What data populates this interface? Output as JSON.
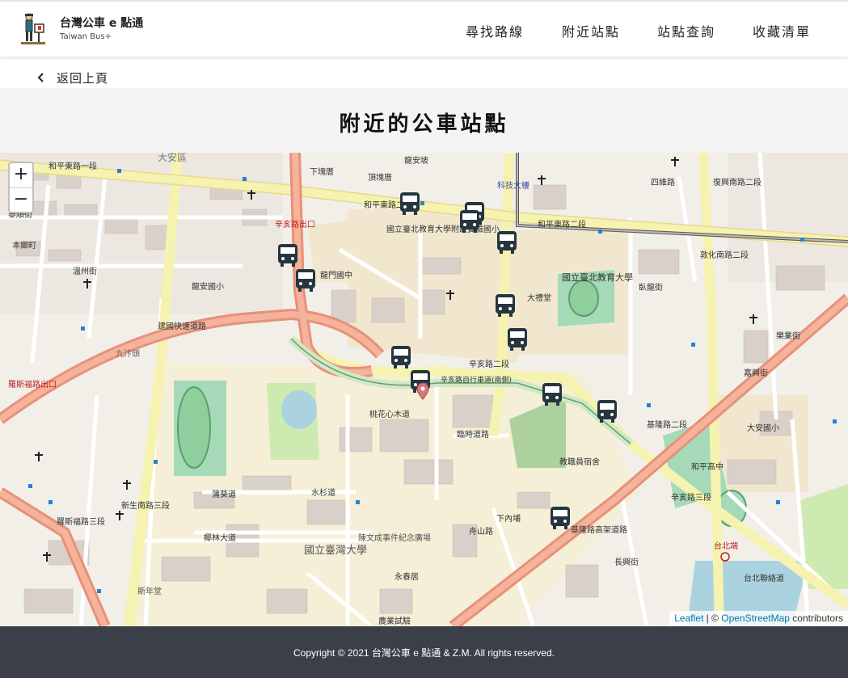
{
  "header": {
    "brand_title": "台灣公車 e 點通",
    "brand_subtitle": "Taiwan Bus+",
    "nav": [
      "尋找路線",
      "附近站點",
      "站點查詢",
      "收藏清單"
    ]
  },
  "back_label": "返回上頁",
  "page_title": "附近的公車站點",
  "map": {
    "zoom_in": "+",
    "zoom_out": "−",
    "attribution": {
      "leaflet": "Leaflet",
      "separator": " | © ",
      "osm": "OpenStreetMap",
      "contributors": " contributors"
    },
    "labels": {
      "l1": "大安區",
      "l2": "和平東路一段",
      "l3": "和平東路二段",
      "l4": "和平東路二段",
      "l5": "辛亥路出口",
      "l6": "龍門國中",
      "l7": "國立臺北教育大學附設實驗國小",
      "l8": "國立臺北教育大學",
      "l9": "大禮堂",
      "l10": "科技大樓",
      "l11": "辛亥路二段",
      "l12": "建國快速道路",
      "l13": "九汴頭",
      "l14": "羅斯福路出口",
      "l15": "辛亥路自行車道(南側)",
      "l16": "桃花心木道",
      "l17": "臨時道路",
      "l18": "教職員宿舍",
      "l19": "蒲葵道",
      "l20": "水杉道",
      "l21": "椰林大道",
      "l22": "國立臺灣大學",
      "l23": "陳文成事件紀念廣場",
      "l24": "舟山路",
      "l25": "永春居",
      "l26": "基隆路高架道路",
      "l27": "基隆路二段",
      "l28": "和平高中",
      "l29": "大安國小",
      "l30": "台北端",
      "l31": "台北聯絡道",
      "l32": "下內埔",
      "l33": "農業試驗",
      "l34": "斯年堂",
      "l35": "龍安國小",
      "l36": "新生南路三段",
      "l37": "羅斯福路三段",
      "l38": "復興南路二段",
      "l39": "敦化南路二段",
      "l40": "嘉興街",
      "l41": "樂業街",
      "l42": "臥龍街",
      "l43": "頂塊厝",
      "l44": "下塊厝",
      "l45": "龍安坡",
      "l46": "本鄉町",
      "l47": "溫州街",
      "l48": "泰順街",
      "l49": "長興街",
      "l50": "辛亥路三段",
      "l51": "四維路"
    }
  },
  "footer": {
    "copyright": "Copyright © 2021 台灣公車 e 點通 & Z.M. All rights reserved."
  }
}
